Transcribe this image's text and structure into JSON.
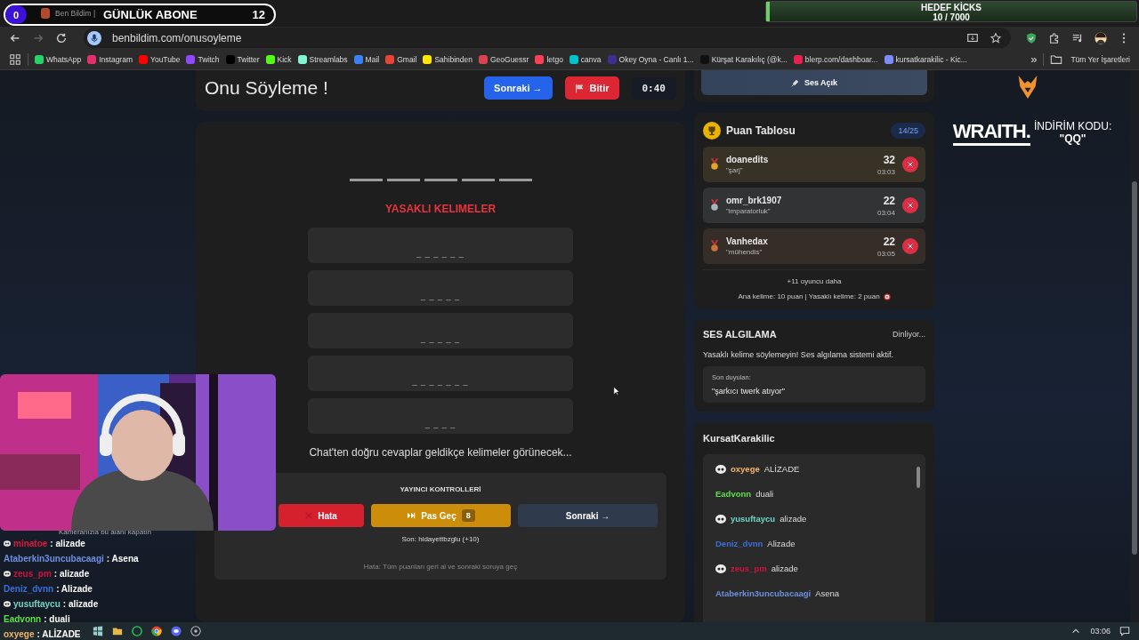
{
  "stream_overlay": {
    "subs_count": "0",
    "subs_label": "GÜNLÜK ABONE",
    "subs_goal": "12",
    "camera_note": "Kameranızla bu alanı kapatın"
  },
  "kicks_goal": {
    "title": "HEDEF KİCKS",
    "progress": "10 / 7000",
    "level": 0.0014
  },
  "browser": {
    "tab_title": "Ben Bildim |",
    "address": "benbildim.com/onusoyleme",
    "bookmarks": [
      {
        "label": "WhatsApp",
        "color": "#25d366"
      },
      {
        "label": "Instagram",
        "color": "#e1306c"
      },
      {
        "label": "YouTube",
        "color": "#ff0000"
      },
      {
        "label": "Twitch",
        "color": "#9146ff"
      },
      {
        "label": "Twitter",
        "color": "#000000"
      },
      {
        "label": "Kick",
        "color": "#53fc18"
      },
      {
        "label": "Streamlabs",
        "color": "#80f5d2"
      },
      {
        "label": "Mail",
        "color": "#3b82f6"
      },
      {
        "label": "Gmail",
        "color": "#ea4335"
      },
      {
        "label": "Sahibinden",
        "color": "#ffe800"
      },
      {
        "label": "GeoGuessr",
        "color": "#d9434f"
      },
      {
        "label": "letgo",
        "color": "#ff3f55"
      },
      {
        "label": "canva",
        "color": "#00c4cc"
      },
      {
        "label": "Okey Oyna - Canlı 1...",
        "color": "#3b2f8f"
      },
      {
        "label": "Kürşat Karakılıç (@k...",
        "color": "#111111"
      },
      {
        "label": "blerp.com/dashboar...",
        "color": "#e8204e"
      },
      {
        "label": "kursatkarakilic - Kic...",
        "color": "#7c8cf8"
      }
    ],
    "more_bookmarks": "»",
    "all_bookmarks": "Tüm Yer İşaretleri"
  },
  "game": {
    "title": "Onu Söyleme !",
    "next_button": "Sonraki →",
    "end_button": "Bitir",
    "timer": "0:40",
    "word_letters": [
      {
        "kind": "blank"
      },
      {
        "kind": "blank"
      },
      {
        "kind": "blank"
      },
      {
        "kind": "blank"
      },
      {
        "kind": "blank"
      }
    ],
    "forbidden_title": "YASAKLI KELIMELER",
    "forbidden_words": [
      "_ _ _ _ _ _",
      "_ _ _ _ _",
      "_ _ _ _ _",
      "_ _ _ _ _ _ _",
      "_ _ _ _"
    ],
    "hint": "Chat'ten doğru cevaplar geldikçe kelimeler görünecek...",
    "controls": {
      "title": "YAYINCI KONTROLLERİ",
      "error_button": "Hata",
      "skip_button": "Pas Geç",
      "skip_count": "8",
      "next_button": "Sonraki →",
      "last": "Son: hidayettbzglu (+10)",
      "note": "Hata: Tüm puanları geri al ve sonraki soruya geç"
    }
  },
  "sound_button": "Ses Açık",
  "leaderboard": {
    "title": "Puan Tablosu",
    "count": "14/25",
    "rows": [
      {
        "name": "doanedits",
        "word": "\"şarj\"",
        "score": "32",
        "time": "03:03",
        "color": "#e0a526"
      },
      {
        "name": "omr_brk1907",
        "word": "\"imparatorluk\"",
        "score": "22",
        "time": "03:04",
        "color": "#a9b4be"
      },
      {
        "name": "Vanhedax",
        "word": "\"mühendis\"",
        "score": "22",
        "time": "03:05",
        "color": "#c8733a"
      }
    ],
    "more": "+11 oyuncu daha",
    "rules": "Ana kelime: 10 puan | Yasaklı kelime: 2 puan"
  },
  "voice": {
    "title": "SES ALGILAMA",
    "status": "Dinliyor...",
    "warning": "Yasaklı kelime söylemeyin! Ses algılama sistemi aktif.",
    "last_label": "Son duyulan:",
    "last_heard": "\"şarkıcı twerk atıyor\""
  },
  "chat": {
    "title": "KursatKarakilic",
    "messages": [
      {
        "user": "oxyege",
        "text": "ALİZADE",
        "color": "#f4b46c",
        "badge": true
      },
      {
        "user": "Eadvonn",
        "text": "duali",
        "color": "#5ee04a",
        "badge": false
      },
      {
        "user": "yusuftaycu",
        "text": "alizade",
        "color": "#6fd6c4",
        "badge": true
      },
      {
        "user": "Deniz_dvnn",
        "text": "Alizade",
        "color": "#3a6fd8",
        "badge": false
      },
      {
        "user": "zeus_pm",
        "text": "alizade",
        "color": "#d0123e",
        "badge": true
      },
      {
        "user": "Ataberkin3uncubacaagi",
        "text": "Asena",
        "color": "#6f8fe0",
        "badge": false
      }
    ]
  },
  "sponsor": {
    "brand": "WRAITH.",
    "code_label": "İNDİRİM KODU:",
    "code": "\"QQ\""
  },
  "overlay_chat": [
    {
      "user": "minatoe",
      "text": ": alizade",
      "color": "#e0183c",
      "badge": true
    },
    {
      "user": "Ataberkin3uncubacaagi",
      "text": ": Asena",
      "color": "#6f8fe0",
      "badge": false
    },
    {
      "user": "zeus_pm",
      "text": ": alizade",
      "color": "#d0123e",
      "badge": true
    },
    {
      "user": "Deniz_dvnn",
      "text": ": Alizade",
      "color": "#3a6fd8",
      "badge": false
    },
    {
      "user": "yusuftaycu",
      "text": ": alizade",
      "color": "#6fd6c4",
      "badge": true
    },
    {
      "user": "Eadvonn",
      "text": ": duali",
      "color": "#5ee04a",
      "badge": false
    },
    {
      "user": "oxyege",
      "text": ": ALİZADE",
      "color": "#f4b46c",
      "badge": false
    }
  ],
  "taskbar": {
    "clock": "03:06"
  }
}
